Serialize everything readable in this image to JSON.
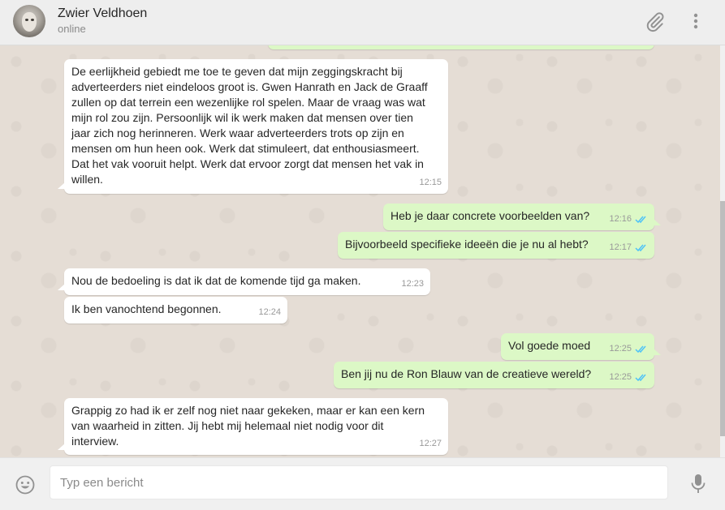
{
  "header": {
    "contact_name": "Zwier Veldhoen",
    "contact_status": "online",
    "icons": [
      "paperclip-icon",
      "menu-dots-icon"
    ]
  },
  "messages": [
    {
      "direction": "in",
      "text": "De eerlijkheid gebiedt me toe te geven dat mijn zeggingskracht bij\nadverteerders niet eindeloos groot is.  Gwen Hanrath en Jack de Graaff\nzullen op dat terrein een wezenlijke rol spelen. Maar de vraag was wat\nmijn rol zou zijn. Persoonlijk wil ik werk maken dat mensen over tien\njaar zich nog herinneren. Werk waar adverteerders trots op zijn en\nmensen om hun heen ook. Werk dat stimuleert, dat enthousiasmeert.\nDat het vak vooruit helpt. Werk dat ervoor zorgt dat mensen het vak in\nwillen.",
      "time": "12:15"
    },
    {
      "direction": "out",
      "text": "Heb je daar concrete voorbeelden van?",
      "time": "12:16",
      "status": "read"
    },
    {
      "direction": "out",
      "text": "Bijvoorbeeld specifieke ideeën die je nu al hebt?",
      "time": "12:17",
      "status": "read"
    },
    {
      "direction": "in",
      "text": "Nou de bedoeling is dat ik dat de komende tijd ga maken.",
      "time": "12:23"
    },
    {
      "direction": "in",
      "text": "Ik ben vanochtend begonnen.",
      "time": "12:24"
    },
    {
      "direction": "out",
      "text": "Vol goede moed",
      "time": "12:25",
      "status": "read"
    },
    {
      "direction": "out",
      "text": "Ben jij nu de Ron Blauw van de creatieve wereld?",
      "time": "12:25",
      "status": "read"
    },
    {
      "direction": "in",
      "text": "Grappig zo had ik er zelf nog niet naar gekeken, maar er kan een kern\nvan waarheid in zitten. Jij hebt mij helemaal niet nodig voor dit\ninterview.",
      "time": "12:27"
    }
  ],
  "composer": {
    "placeholder": "Typ een bericht",
    "value": ""
  },
  "colors": {
    "header_bg": "#eeeeee",
    "chat_bg": "#e5ddd5",
    "incoming_bubble": "#ffffff",
    "outgoing_bubble": "#dcf8c6",
    "read_tick": "#4fc3f7"
  },
  "footer_icons": [
    "emoji-icon",
    "microphone-icon"
  ]
}
